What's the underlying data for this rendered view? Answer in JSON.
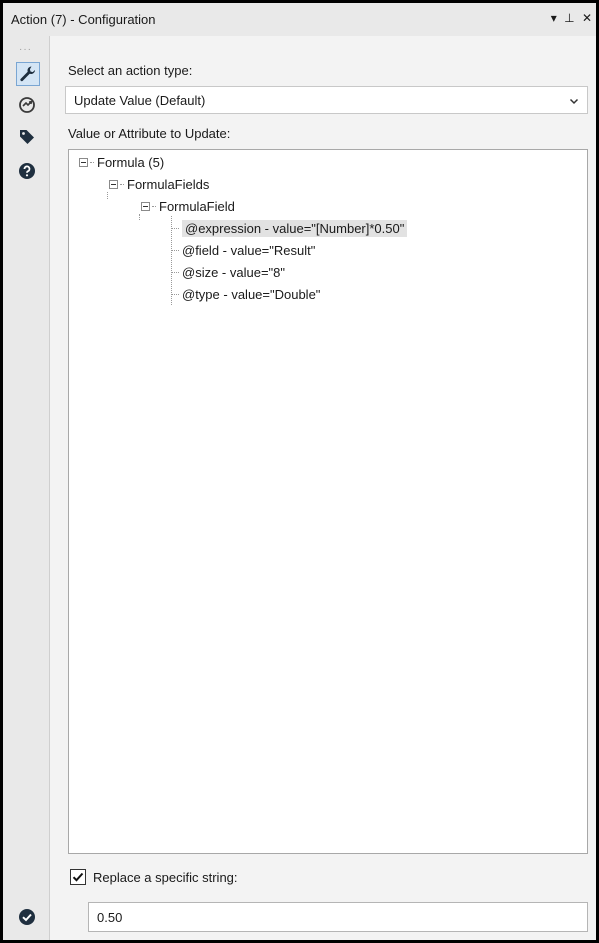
{
  "window": {
    "title": "Action (7) - Configuration",
    "controls": {
      "menu_glyph": "▾",
      "pin_glyph": "⊥",
      "close_glyph": "✕"
    }
  },
  "toolstrip": {
    "dots": "···",
    "icons": [
      {
        "name": "wrench-icon",
        "active": true
      },
      {
        "name": "connect-icon",
        "active": false
      },
      {
        "name": "tag-icon",
        "active": false
      },
      {
        "name": "help-icon",
        "active": false
      }
    ],
    "bottom_icon": "check-circle-icon"
  },
  "action_type": {
    "label": "Select an action type:",
    "selected": "Update Value (Default)"
  },
  "tree": {
    "label": "Value or Attribute to Update:",
    "nodes": [
      {
        "text": "Formula (5)",
        "depth": 0,
        "expander": true
      },
      {
        "text": "FormulaFields",
        "depth": 1,
        "expander": true
      },
      {
        "text": "FormulaField",
        "depth": 2,
        "expander": true
      },
      {
        "text": "@expression - value=\"[Number]*0.50\"",
        "depth": 3,
        "selected": true
      },
      {
        "text": "@field - value=\"Result\"",
        "depth": 3
      },
      {
        "text": "@size - value=\"8\"",
        "depth": 3
      },
      {
        "text": "@type - value=\"Double\"",
        "depth": 3
      }
    ]
  },
  "replace": {
    "label": "Replace a specific string:",
    "checked": true,
    "value": "0.50"
  },
  "colors": {
    "panel_bg": "#f3f3f3",
    "strip_bg": "#e9e9e9",
    "active_tool_bg": "#d4e5f5",
    "selected_row_bg": "#e2e2e2"
  }
}
